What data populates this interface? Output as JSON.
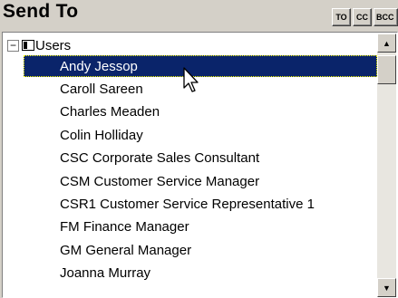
{
  "header": {
    "title": "Send To",
    "buttons": [
      "TO",
      "CC",
      "BCC"
    ]
  },
  "tree": {
    "root_label": "Users",
    "expander_glyph": "−",
    "items": [
      "Andy Jessop",
      "Caroll Sareen",
      "Charles Meaden",
      "Colin Holliday",
      "CSC Corporate Sales Consultant",
      "CSM Customer Service Manager",
      "CSR1 Customer Service Representative 1",
      "FM Finance Manager",
      "GM General Manager",
      "Joanna Murray"
    ],
    "selected_index": 0
  },
  "scrollbar": {
    "up_glyph": "▲",
    "down_glyph": "▼"
  },
  "colors": {
    "selection_bg": "#0a246a",
    "selection_text": "#ffffff",
    "window_bg": "#d4d0c8"
  }
}
